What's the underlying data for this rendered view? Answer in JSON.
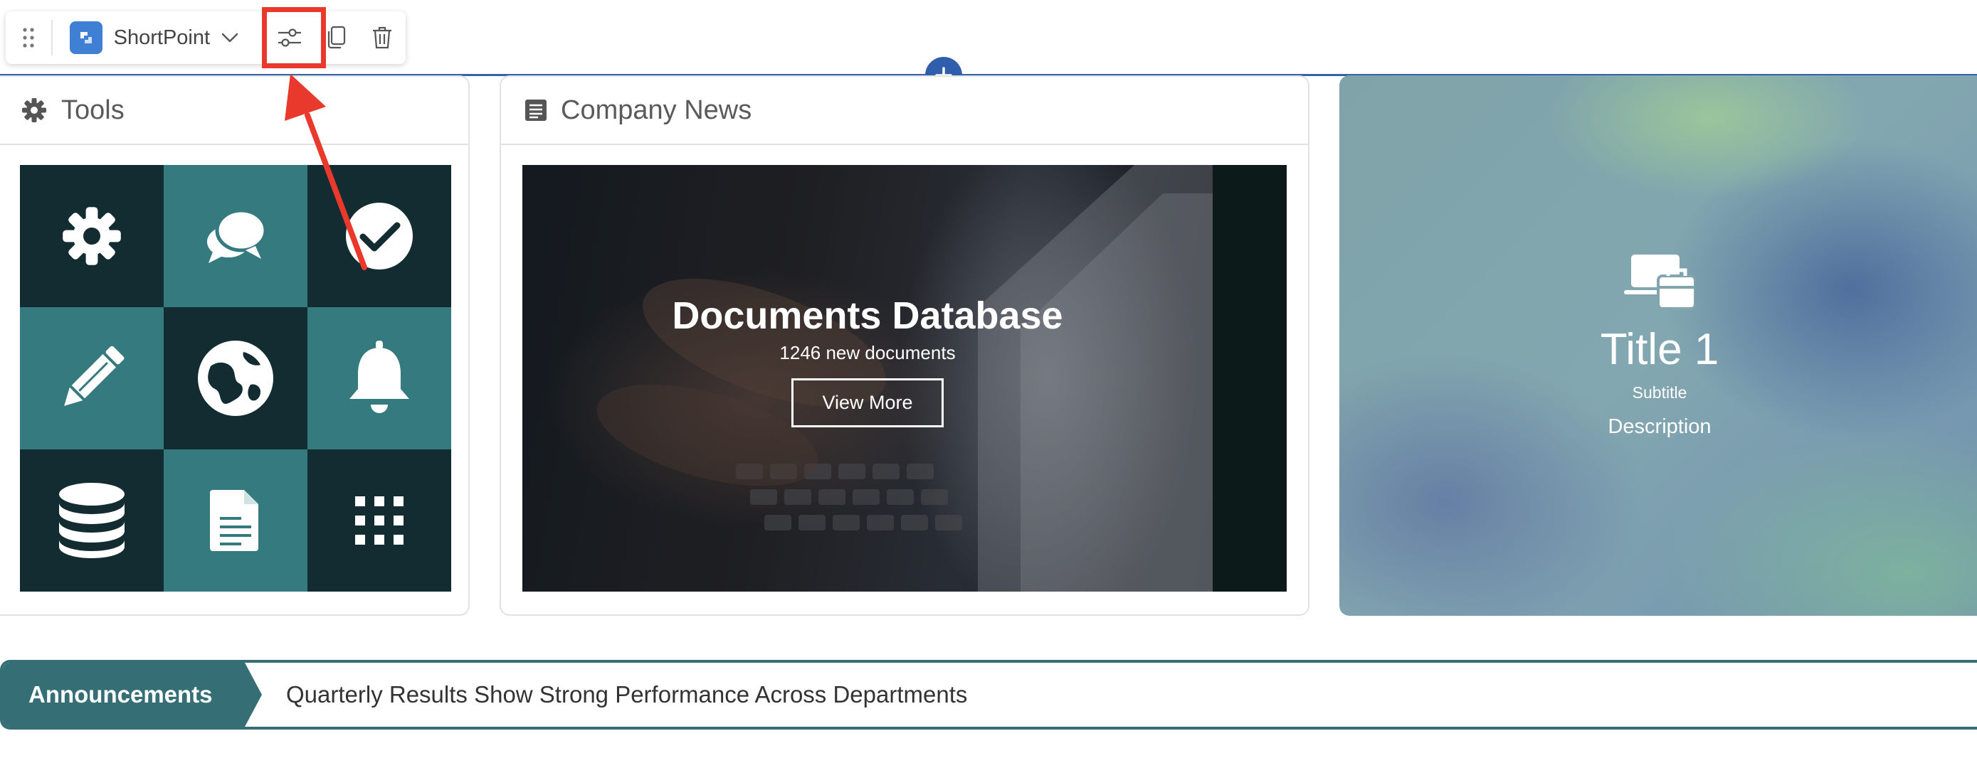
{
  "toolbar": {
    "brand_name": "ShortPoint",
    "actions": {
      "settings": "sliders-icon",
      "duplicate": "copy-icon",
      "delete": "trash-icon"
    }
  },
  "colors": {
    "accent_blue": "#2f5fac",
    "teal_dark": "#132c32",
    "teal_light": "#357a7e",
    "announce_teal": "#356f75",
    "highlight_red": "#e8392c"
  },
  "tools_card": {
    "title": "Tools",
    "tiles": [
      {
        "icon": "gear-icon"
      },
      {
        "icon": "chat-bubbles-icon"
      },
      {
        "icon": "check-circle-icon"
      },
      {
        "icon": "pencil-icon"
      },
      {
        "icon": "globe-icon"
      },
      {
        "icon": "bell-icon"
      },
      {
        "icon": "database-icon"
      },
      {
        "icon": "document-icon"
      },
      {
        "icon": "apps-grid-icon"
      }
    ]
  },
  "news_card": {
    "title": "Company News",
    "banner_title": "Documents Database",
    "banner_subtitle": "1246 new documents",
    "button_label": "View More"
  },
  "hero": {
    "icon": "laptop-briefcase-icon",
    "title": "Title 1",
    "subtitle": "Subtitle",
    "description": "Description"
  },
  "announcements": {
    "label": "Announcements",
    "text": "Quarterly Results Show Strong Performance Across Departments"
  }
}
